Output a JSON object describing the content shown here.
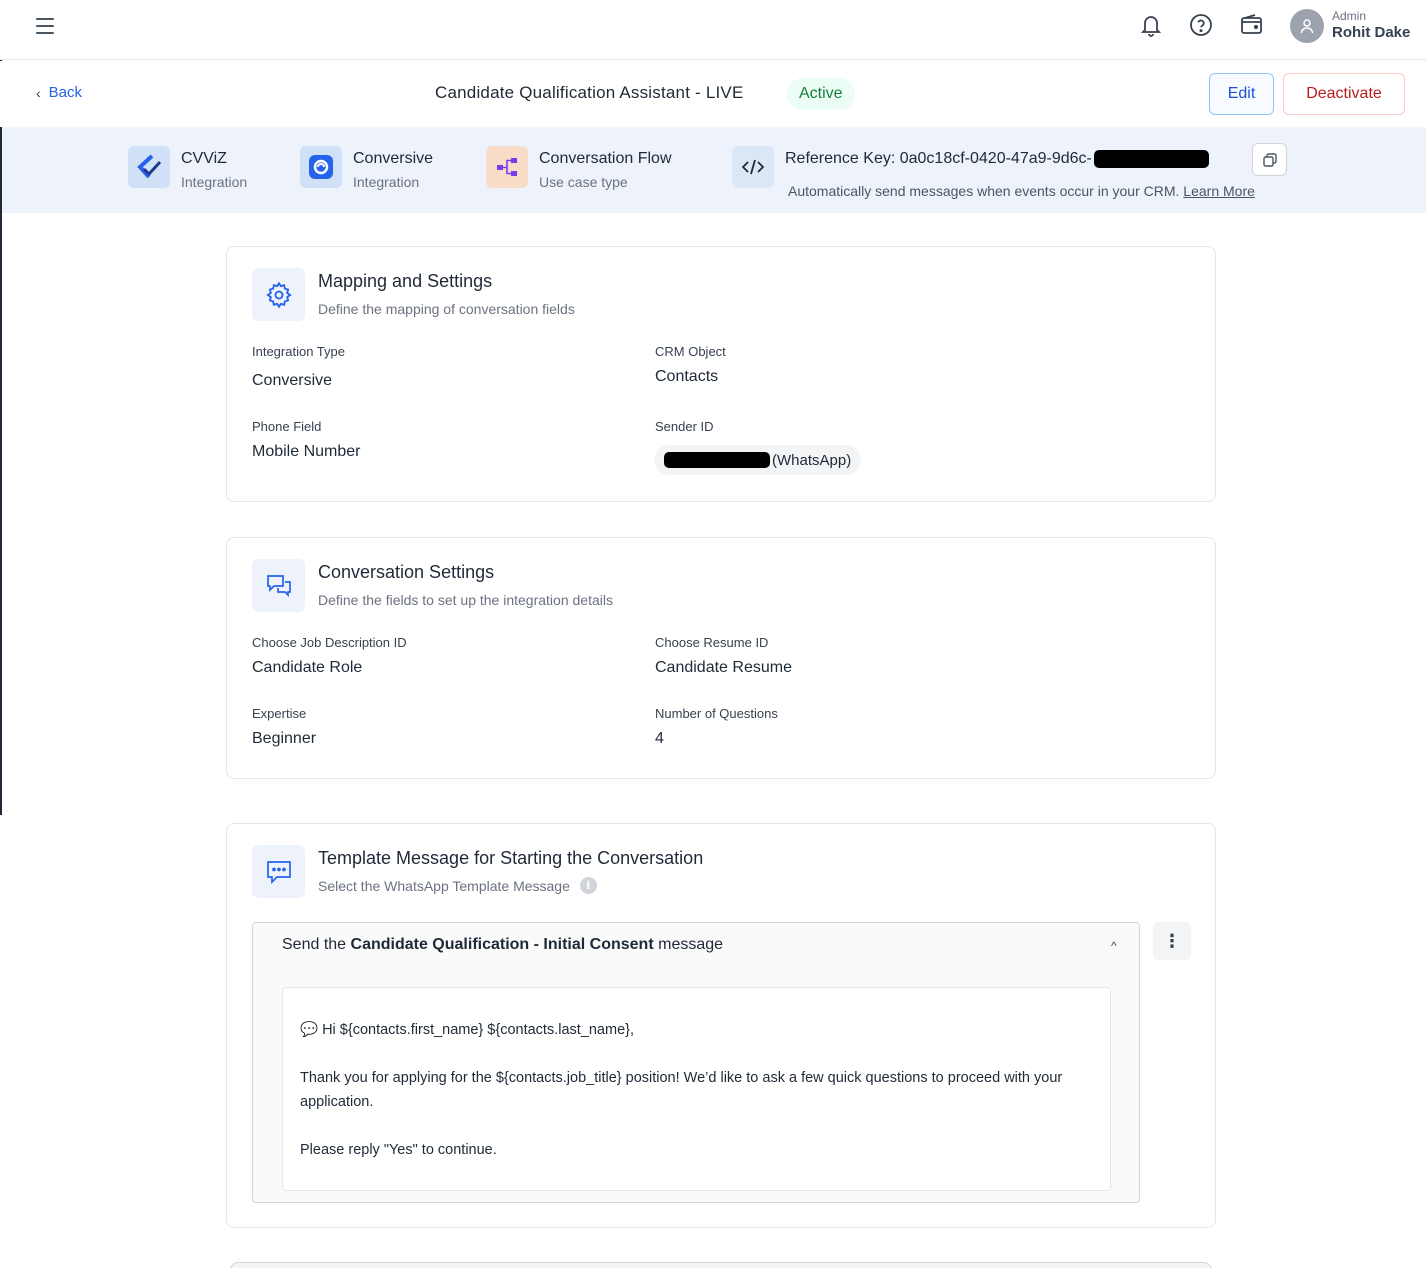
{
  "topbar": {
    "user_role": "Admin",
    "user_name": "Rohit Dake"
  },
  "header": {
    "back_label": "Back",
    "title": "Candidate Qualification Assistant - LIVE",
    "status": "Active",
    "edit_label": "Edit",
    "deactivate_label": "Deactivate"
  },
  "strip": {
    "items": [
      {
        "title": "CVViZ",
        "subtitle": "Integration"
      },
      {
        "title": "Conversive",
        "subtitle": "Integration"
      },
      {
        "title": "Conversation Flow",
        "subtitle": "Use case type"
      }
    ],
    "reference_key": "Reference Key: 0a0c18cf-0420-47a9-9d6c-",
    "description": "Automatically send messages when events occur in your CRM.",
    "learn_more": "Learn More"
  },
  "mapping": {
    "title": "Mapping and Settings",
    "subtitle": "Define the mapping of conversation fields",
    "integration_type_label": "Integration Type",
    "integration_type_value": "Conversive",
    "crm_object_label": "CRM Object",
    "crm_object_value": "Contacts",
    "phone_field_label": "Phone Field",
    "phone_field_value": "Mobile Number",
    "sender_id_label": "Sender ID",
    "sender_id_suffix": "(WhatsApp)"
  },
  "conversation": {
    "title": "Conversation Settings",
    "subtitle": "Define the fields to set up the integration details",
    "jd_label": "Choose Job Description ID",
    "jd_value": "Candidate Role",
    "resume_label": "Choose Resume ID",
    "resume_value": "Candidate Resume",
    "expertise_label": "Expertise",
    "expertise_value": "Beginner",
    "questions_label": "Number of Questions",
    "questions_value": "4"
  },
  "template": {
    "title": "Template Message for Starting the Conversation",
    "subtitle": "Select the WhatsApp Template Message",
    "head_prefix": "Send the",
    "head_name": "Candidate Qualification - Initial Consent",
    "head_suffix": "message",
    "message_lines": [
      "💬 Hi ${contacts.first_name} ${contacts.last_name},",
      "Thank you for applying for the ${contacts.job_title} position! We’d like to ask a few quick questions to proceed with your application.",
      "Please reply \"Yes\" to continue."
    ]
  }
}
